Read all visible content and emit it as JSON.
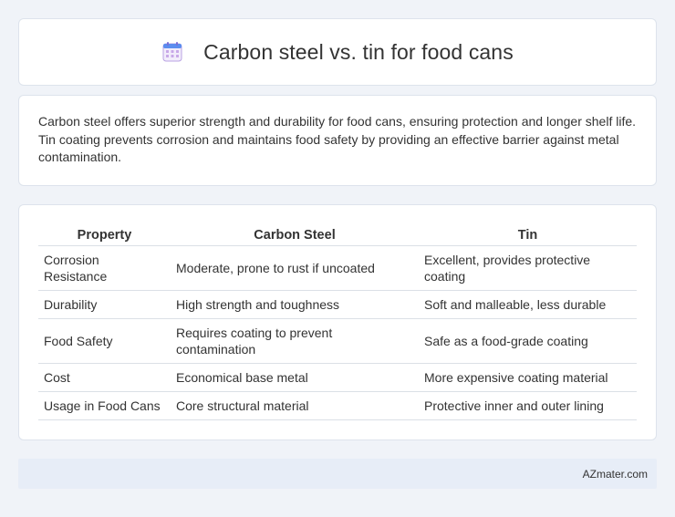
{
  "header": {
    "title": "Carbon steel vs. tin for food cans",
    "icon": "calendar-icon",
    "icon_colors": {
      "top": "#5b8def",
      "grid": "#c8a8e8",
      "body": "#f2ecfb"
    }
  },
  "description": {
    "text": "Carbon steel offers superior strength and durability for food cans, ensuring protection and longer shelf life. Tin coating prevents corrosion and maintains food safety by providing an effective barrier against metal contamination."
  },
  "table": {
    "headers": [
      "Property",
      "Carbon Steel",
      "Tin"
    ],
    "rows": [
      [
        "Corrosion Resistance",
        "Moderate, prone to rust if uncoated",
        "Excellent, provides protective coating"
      ],
      [
        "Durability",
        "High strength and toughness",
        "Soft and malleable, less durable"
      ],
      [
        "Food Safety",
        "Requires coating to prevent contamination",
        "Safe as a food-grade coating"
      ],
      [
        "Cost",
        "Economical base metal",
        "More expensive coating material"
      ],
      [
        "Usage in Food Cans",
        "Core structural material",
        "Protective inner and outer lining"
      ]
    ]
  },
  "footer": {
    "brand": "AZmater.com"
  },
  "colors": {
    "background": "#f0f3f8",
    "card": "#ffffff",
    "footer_bar": "#e7edf7",
    "text": "#333333"
  }
}
